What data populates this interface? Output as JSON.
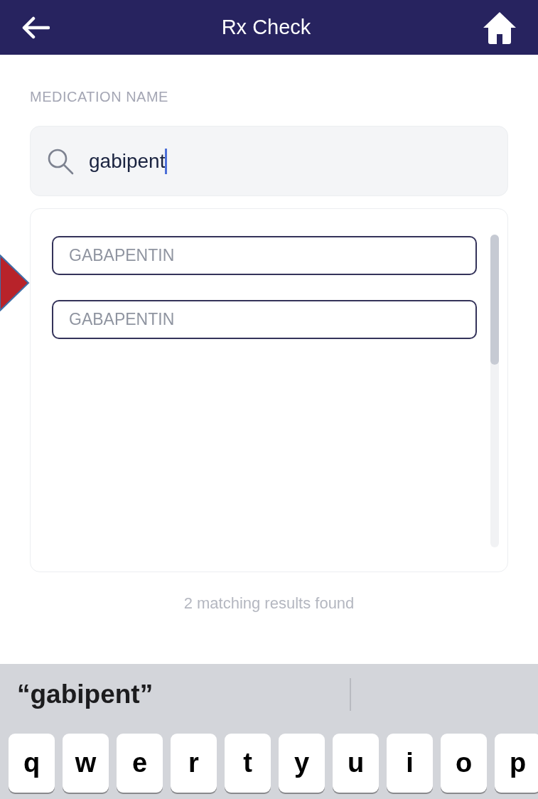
{
  "header": {
    "title": "Rx Check"
  },
  "search": {
    "label": "MEDICATION NAME",
    "value": "gabipent"
  },
  "results": [
    {
      "label": "GABAPENTIN"
    },
    {
      "label": "GABAPENTIN"
    }
  ],
  "result_count": "2 matching results found",
  "keyboard": {
    "suggestions": [
      "“gabipent”"
    ],
    "keys": [
      "q",
      "w",
      "e",
      "r",
      "t",
      "y",
      "u",
      "i",
      "o",
      "p"
    ]
  }
}
